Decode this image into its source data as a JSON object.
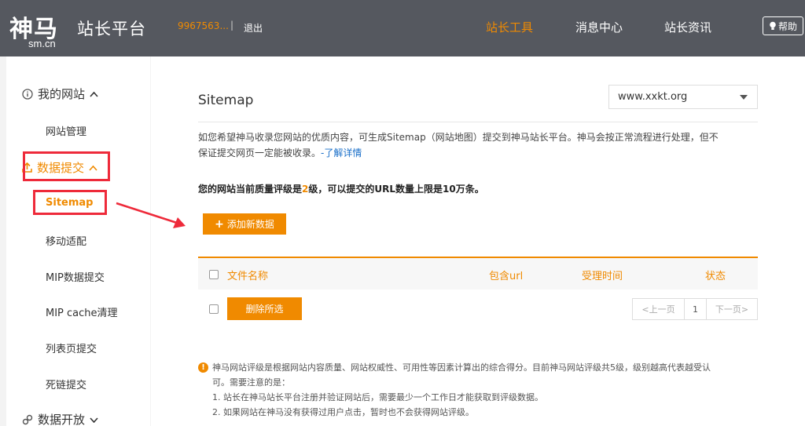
{
  "header": {
    "logo_main": "神马",
    "logo_sub": "sm.cn",
    "logo_title": "站长平台",
    "user_id": "9967563...",
    "divider": "|",
    "logout": "退出",
    "nav": [
      "站长工具",
      "消息中心",
      "站长资讯"
    ],
    "help": "帮助"
  },
  "sidebar": {
    "groups": {
      "my_site": "我的网站",
      "data_submit": "数据提交",
      "data_open": "数据开放"
    },
    "items": {
      "site_manage": "网站管理",
      "sitemap": "Sitemap",
      "mobile_adapt": "移动适配",
      "mip_submit": "MIP数据提交",
      "mip_cache": "MIP cache清理",
      "list_page": "列表页提交",
      "dead_link": "死链提交"
    }
  },
  "main": {
    "title": "Sitemap",
    "site_select": "www.xxkt.org",
    "desc_line1": "如您希望神马收录您网站的优质内容，可生成Sitemap（网站地图）提交到神马站长平台。神马会按正常流程进行处理，但不",
    "desc_line2": "保证提交网页一定能被收录。",
    "desc_link": "-了解详情",
    "level_prefix": "您的网站当前质量评级是",
    "level_value": "2",
    "level_suffix": "级，可以提交的URL数量上限是10万条。",
    "add_button": "添加新数据",
    "table": {
      "col_name": "文件名称",
      "col_url": "包含url",
      "col_time": "受理时间",
      "col_status": "状态"
    },
    "delete_button": "删除所选",
    "pager": {
      "prev": "<上一页",
      "page": "1",
      "next": "下一页>"
    },
    "notice": [
      "神马网站评级是根据网站内容质量、网站权威性、可用性等因素计算出的综合得分。目前神马网站评级共5级，级别越高代表越受认",
      "可。需要注意的是：",
      "1. 站长在神马站长平台注册并验证网站后，需要最少一个工作日才能获取到评级数据。",
      "2. 如果网站在神马没有获得过用户点击，暂时也不会获得网站评级。"
    ]
  },
  "colors": {
    "accent": "#f08a00",
    "highlight": "#ee2a3a",
    "header_bg": "#55585f"
  }
}
